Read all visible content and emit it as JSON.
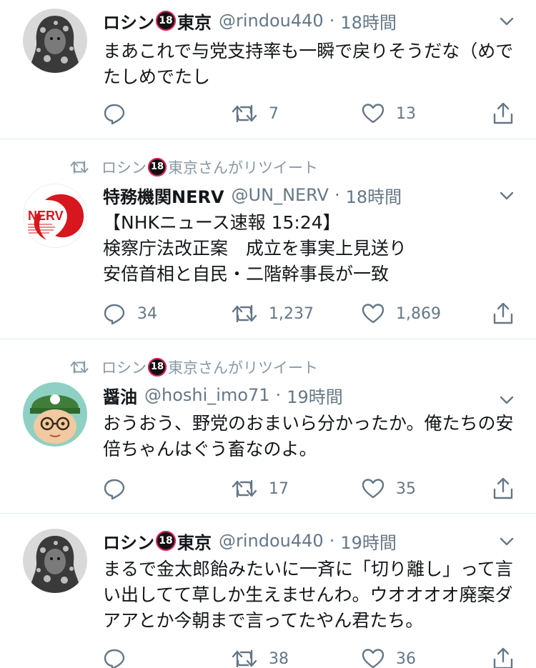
{
  "tweets": [
    {
      "retweeted_by": "",
      "name_pre": "ロシン",
      "name_badge": "18",
      "name_post": "東京",
      "handle": "@rindou440",
      "time": "18時間",
      "text": "まあこれで与党支持率も一瞬で戻りそうだな（めでたしめでたし",
      "replies": "",
      "retweets": "7",
      "likes": "13"
    },
    {
      "retweeted_by": "東京さんがリツイート",
      "retweeted_by_pre": "ロシン",
      "name_pre": "特務機関NERV",
      "name_badge": "",
      "name_post": "",
      "handle": "@UN_NERV",
      "time": "18時間",
      "text": "【NHKニュース速報 15:24】\n検察庁法改正案　成立を事実上見送り\n安倍首相と自民・二階幹事長が一致",
      "replies": "34",
      "retweets": "1,237",
      "likes": "1,869",
      "avatar_text": "NERV"
    },
    {
      "retweeted_by": "東京さんがリツイート",
      "retweeted_by_pre": "ロシン",
      "name_pre": "醤油",
      "name_badge": "",
      "name_post": "",
      "handle": "@hoshi_imo71",
      "time": "19時間",
      "text": "おうおう、野党のおまいら分かったか。俺たちの安倍ちゃんはぐう畜なのよ。",
      "replies": "",
      "retweets": "17",
      "likes": "35"
    },
    {
      "retweeted_by": "",
      "name_pre": "ロシン",
      "name_badge": "18",
      "name_post": "東京",
      "handle": "@rindou440",
      "time": "19時間",
      "text": "まるで金太郎飴みたいに一斉に「切り離し」って言い出してて草しか生えませんわ。ウオオオオ廃案ダアアとか今朝まで言ってたやん君たち。",
      "replies": "",
      "retweets": "38",
      "likes": "36"
    }
  ],
  "rt_badge": "18",
  "colors": {
    "muted": "#657786",
    "divider": "#e1e8ed",
    "badge_ring": "#e0245e",
    "nerv_red": "#d7161d"
  },
  "icons": [
    "reply-icon",
    "retweet-icon",
    "like-icon",
    "share-icon",
    "chevron-down-icon"
  ]
}
